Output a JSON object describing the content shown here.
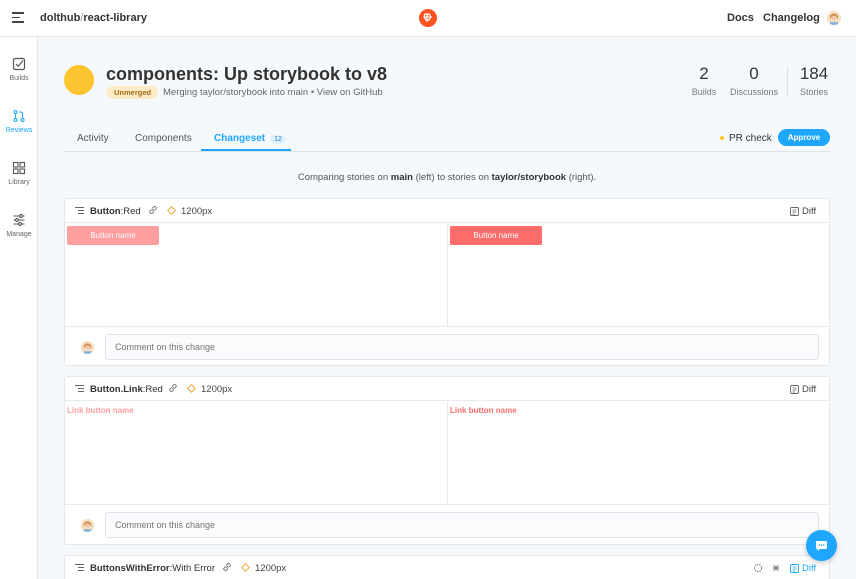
{
  "topbar": {
    "org": "dolthub",
    "separator": "/",
    "project": "react-library",
    "docs": "Docs",
    "changelog": "Changelog",
    "logo_color": "#fc521f"
  },
  "sidebar": {
    "items": [
      {
        "label": "Builds",
        "icon": "checkbox-icon"
      },
      {
        "label": "Reviews",
        "icon": "pull-request-icon",
        "active": true
      },
      {
        "label": "Library",
        "icon": "grid-icon"
      },
      {
        "label": "Manage",
        "icon": "sliders-icon"
      }
    ]
  },
  "header": {
    "title": "components: Up storybook to v8",
    "status_badge": "Unmerged",
    "merging_text": "Merging taylor/storybook into main • View on GitHub",
    "stats": {
      "builds": {
        "value": "2",
        "label": "Builds"
      },
      "discussions": {
        "value": "0",
        "label": "Discussions"
      },
      "stories": {
        "value": "184",
        "label": "Stories"
      }
    }
  },
  "tabs": {
    "activity": "Activity",
    "components": "Components",
    "changeset": "Changeset",
    "changeset_count": "12",
    "pr_check": "PR check",
    "approve": "Approve"
  },
  "comparing": {
    "prefix": "Comparing stories on ",
    "base": "main",
    "middle": " (left) to stories on ",
    "head": "taylor/storybook",
    "suffix": " (right)."
  },
  "changes": [
    {
      "component": "Button",
      "story": ":Red",
      "viewport": "1200px",
      "diff_label": "Diff",
      "left_text": "Button name",
      "right_text": "Button name",
      "comment_placeholder": "Comment on this change"
    },
    {
      "component": "Button.Link",
      "story": ":Red",
      "viewport": "1200px",
      "diff_label": "Diff",
      "left_text": "Link button name",
      "right_text": "Link button name",
      "comment_placeholder": "Comment on this change"
    },
    {
      "component": "ButtonsWithError",
      "story": ":With Error",
      "viewport": "1200px",
      "diff_label": "Diff"
    }
  ],
  "colors": {
    "accent": "#1ea7fd",
    "status_yellow": "#fcc42e",
    "button_old": "#ff9e9e",
    "button_new": "#ff6c6c"
  }
}
